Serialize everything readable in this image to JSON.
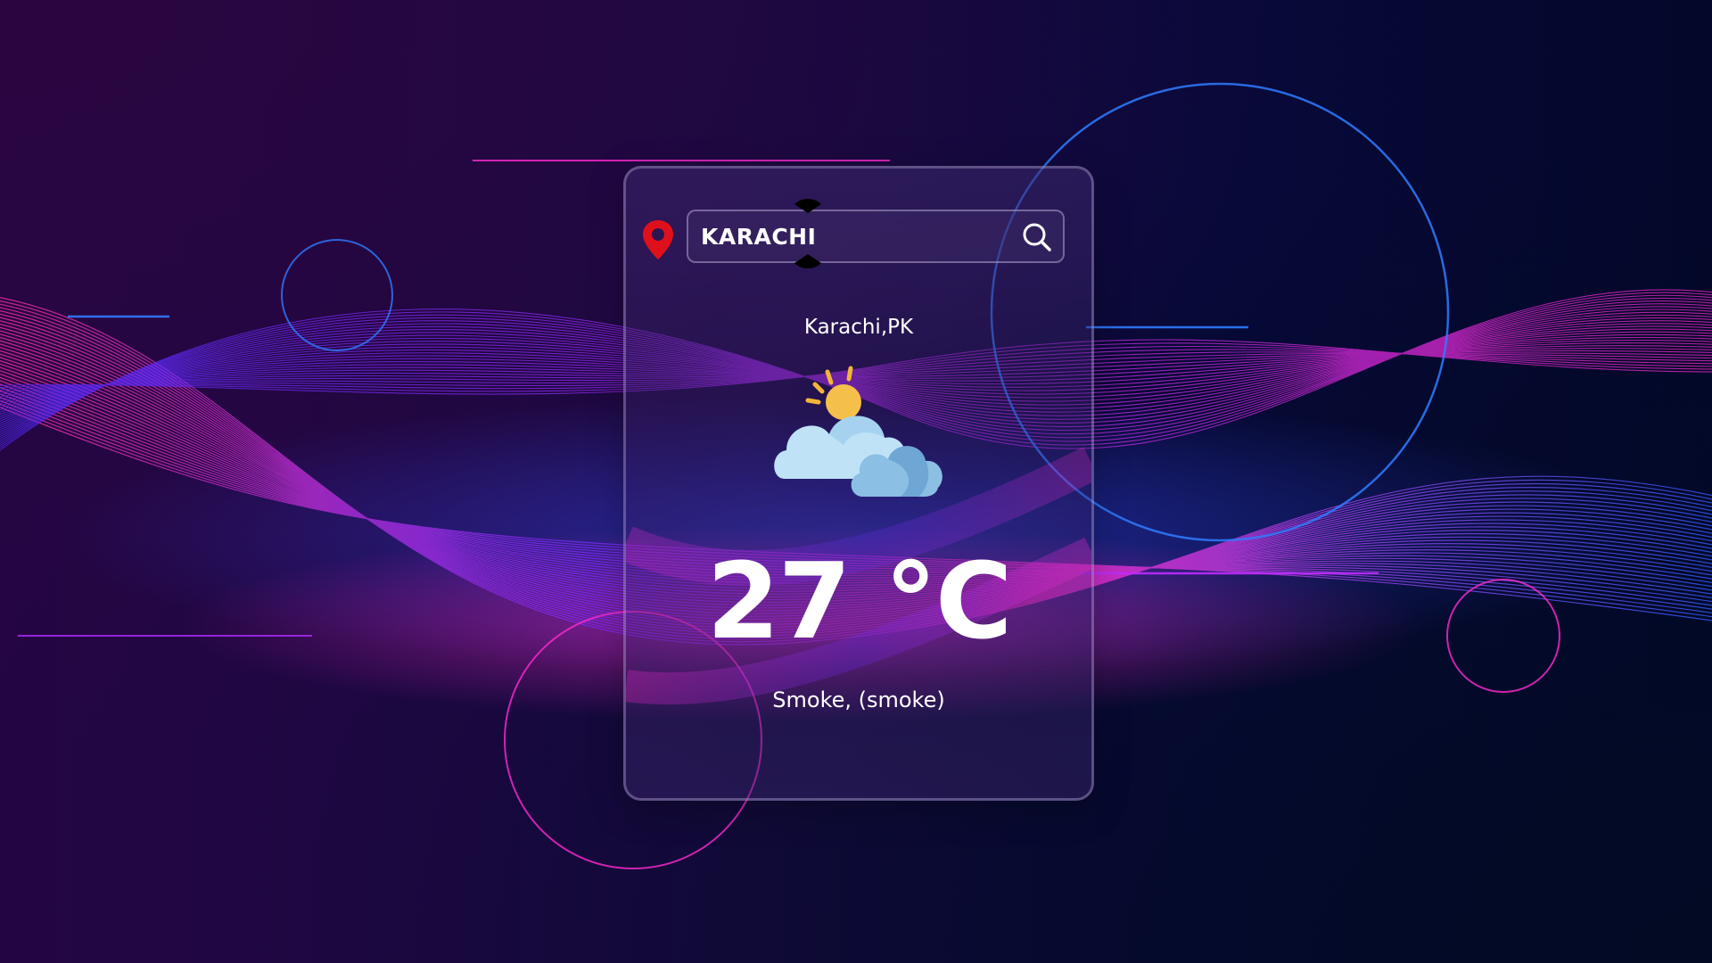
{
  "search": {
    "value": "KARACHI",
    "placeholder": ""
  },
  "weather": {
    "location": "Karachi,PK",
    "temperature": "27 °C",
    "description": "Smoke, (smoke)",
    "icon": "partly-cloudy-icon"
  },
  "icons": {
    "location": "location-pin-icon",
    "search": "search-icon"
  },
  "colors": {
    "pin": "#e0101a",
    "text": "#ffffff",
    "accent_pink": "#ff2bd0",
    "accent_blue": "#2f7bff"
  }
}
